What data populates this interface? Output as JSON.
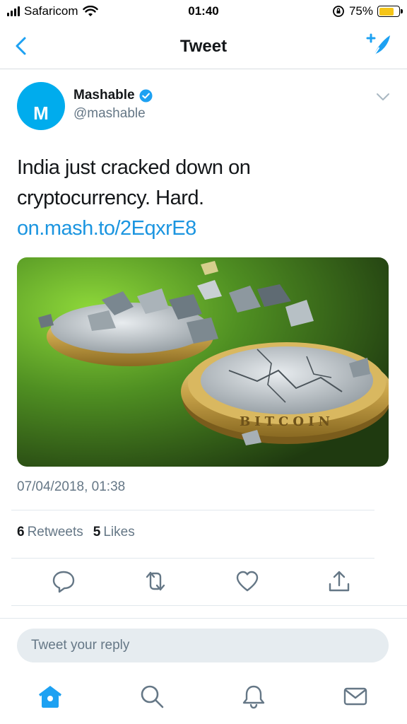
{
  "status_bar": {
    "carrier": "Safaricom",
    "time": "01:40",
    "battery_percent": "75%",
    "battery_level": 0.75,
    "battery_color": "#f5c518"
  },
  "nav": {
    "title": "Tweet",
    "back_icon": "chevron-left-icon",
    "compose_icon": "compose-tweet-icon"
  },
  "tweet": {
    "author_name": "Mashable",
    "author_handle": "@mashable",
    "avatar_letter": "M",
    "avatar_color": "#00aced",
    "verified": true,
    "text": "India just cracked down on cryptocurrency. Hard.",
    "link": "on.mash.to/2EqxrE8",
    "media": "image of a broken bitcoin coin on a green background",
    "timestamp": "07/04/2018, 01:38",
    "retweets_count": "6",
    "retweets_label": "Retweets",
    "likes_count": "5",
    "likes_label": "Likes"
  },
  "actions": [
    "reply-icon",
    "retweet-icon",
    "like-icon",
    "share-icon"
  ],
  "reply": {
    "placeholder": "Tweet your reply"
  },
  "tab_bar": [
    "home-icon",
    "search-icon",
    "notifications-icon",
    "messages-icon"
  ],
  "colors": {
    "accent": "#1da1f2",
    "link": "#1b95e0",
    "secondary_text": "#657786"
  }
}
